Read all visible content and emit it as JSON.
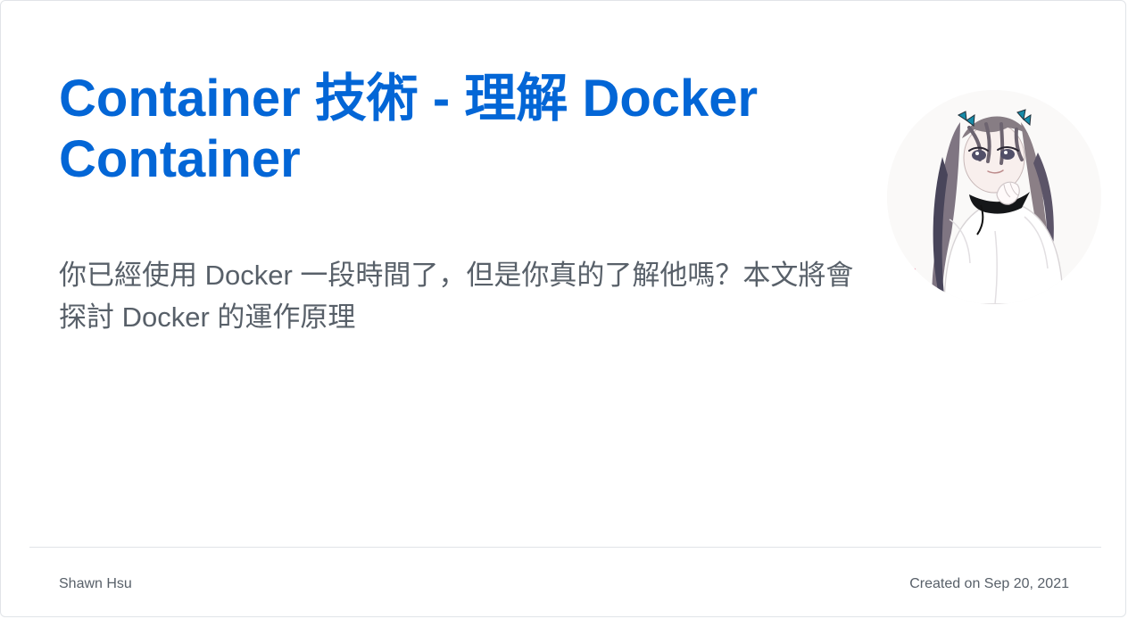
{
  "post": {
    "title": "Container 技術 - 理解 Docker Container",
    "description": "你已經使用 Docker 一段時間了，但是你真的了解他嗎？本文將會探討 Docker 的運作原理"
  },
  "footer": {
    "author": "Shawn Hsu",
    "created": "Created on Sep 20, 2021"
  },
  "avatar": {
    "icon": "anime-girl-avatar",
    "background_color": "#faf9f8"
  },
  "colors": {
    "title": "#0366d6",
    "text": "#586069",
    "border": "#e1e4e8"
  }
}
